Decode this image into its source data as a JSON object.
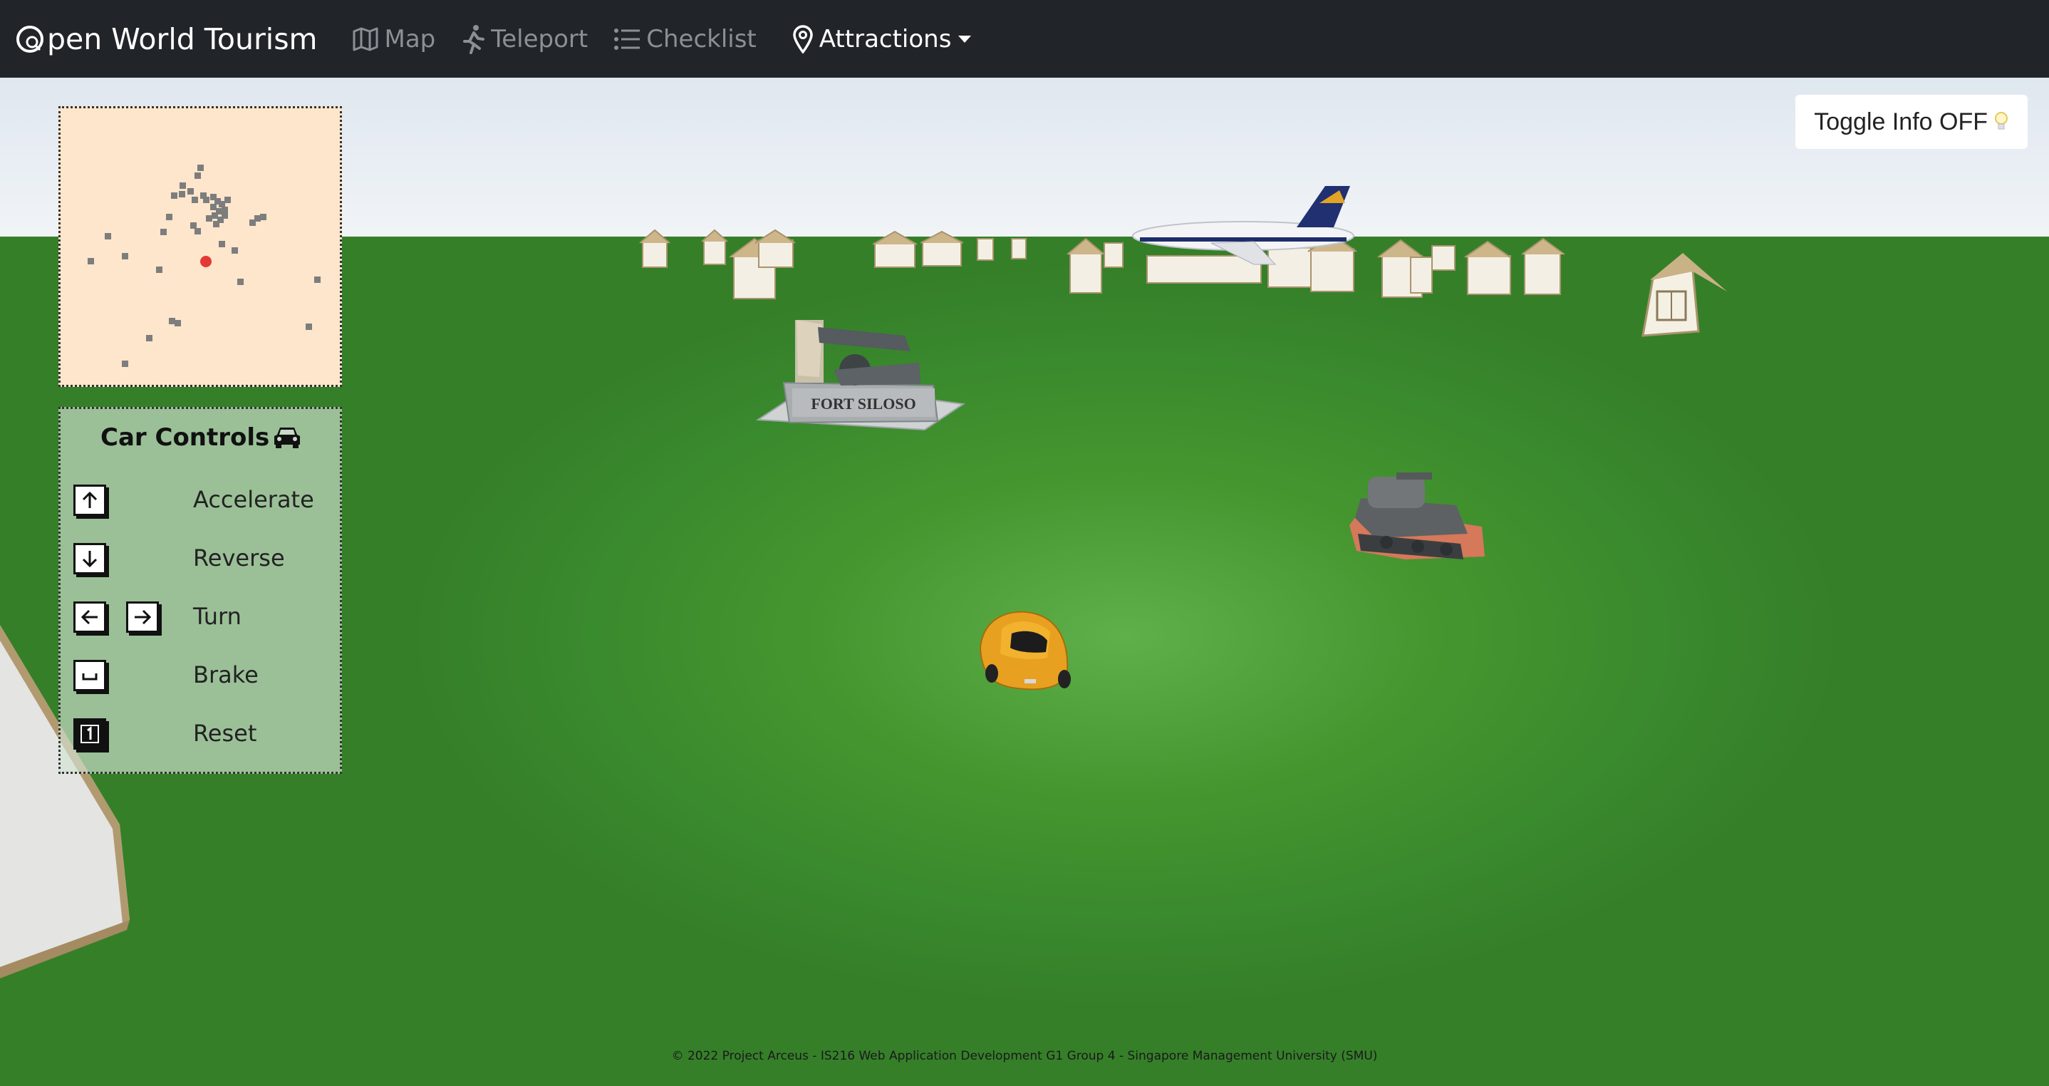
{
  "navbar": {
    "brand": "pen World Tourism",
    "items": [
      {
        "label": "Map",
        "icon": "map-icon"
      },
      {
        "label": "Teleport",
        "icon": "person-running-icon"
      },
      {
        "label": "Checklist",
        "icon": "list-icon"
      },
      {
        "label": "Attractions",
        "icon": "map-pin-icon",
        "dropdown": true
      }
    ]
  },
  "scene": {
    "toggle_info_label": "Toggle Info OFF",
    "toggle_info_icon": "lightbulb-icon",
    "landmark_sign": "FORT SILOSO"
  },
  "car_controls": {
    "title": "Car Controls",
    "title_icon": "car-icon",
    "rows": [
      {
        "keys": [
          "arrow-up-key-icon"
        ],
        "label": "Accelerate"
      },
      {
        "keys": [
          "arrow-down-key-icon"
        ],
        "label": "Reverse"
      },
      {
        "keys": [
          "arrow-left-key-icon",
          "arrow-right-key-icon"
        ],
        "label": "Turn"
      },
      {
        "keys": [
          "space-key-icon"
        ],
        "label": "Brake"
      },
      {
        "keys": [
          "one-key-icon"
        ],
        "label": "Reset"
      }
    ]
  },
  "footer": {
    "text": "© 2022 Project Arceus - IS216 Web Application Development G1 Group 4 - Singapore Management University (SMU)"
  },
  "colors": {
    "navbar": "#212529",
    "ground": "#3a8a2e",
    "minimap_bg": "#fde6cc",
    "player_marker": "#e53935"
  }
}
